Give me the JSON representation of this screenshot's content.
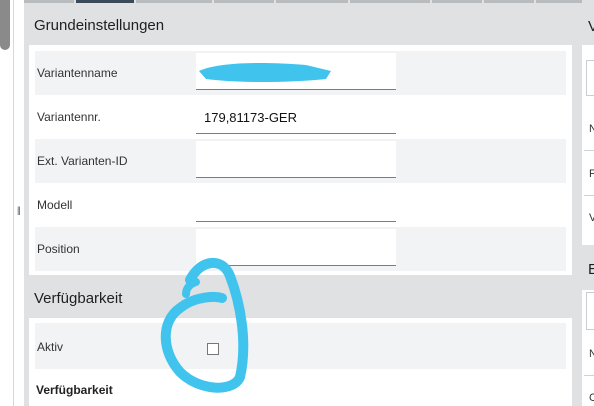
{
  "grundeinstellungen": {
    "title": "Grundeinstellungen",
    "fields": [
      {
        "label": "Variantenname",
        "value": ""
      },
      {
        "label": "Variantennr.",
        "value": "179,81173-GER"
      },
      {
        "label": "Ext. Varianten-ID",
        "value": ""
      },
      {
        "label": "Modell",
        "value": ""
      },
      {
        "label": "Position",
        "value": ""
      }
    ]
  },
  "verfuegbarkeit": {
    "title": "Verfügbarkeit",
    "aktiv_label": "Aktiv",
    "aktiv_checked": false,
    "sub_label": "Verfügbarkeit"
  },
  "right_column": {
    "header_1": "V",
    "letters": [
      "N",
      "F",
      "V"
    ],
    "header_2": "E",
    "letters_2": [
      "N",
      "C"
    ]
  },
  "annotation_colors": {
    "redaction": "#40c4ee",
    "marker": "#40c4ee"
  }
}
